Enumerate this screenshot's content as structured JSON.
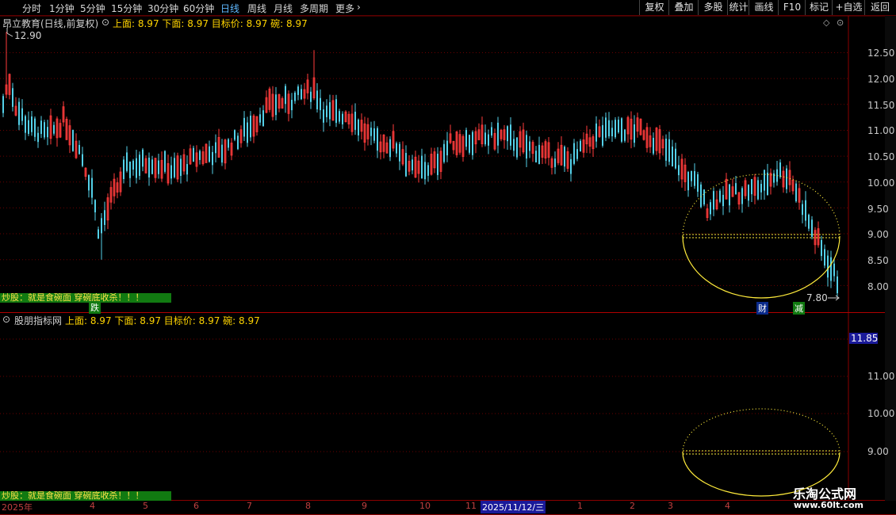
{
  "toolbar": {
    "periods": [
      "分时",
      "1分钟",
      "5分钟",
      "15分钟",
      "30分钟",
      "60分钟",
      "日线",
      "周线",
      "月线",
      "多周期",
      "更多"
    ],
    "active_period": "日线",
    "right_buttons": [
      "复权",
      "叠加",
      "多股",
      "统计",
      "画线",
      "F10",
      "标记",
      "+自选",
      "返回"
    ]
  },
  "main_panel": {
    "title": "昂立教育(日线,前复权)",
    "indicators": "上面: 8.97  下面: 8.97  目标价: 8.97  碗: 8.97",
    "high_label": "12.90",
    "low_label": "7.80",
    "y_ticks": [
      "12.50",
      "12.00",
      "11.50",
      "11.00",
      "10.50",
      "10.00",
      "9.50",
      "9.00",
      "8.50",
      "8.00"
    ],
    "banner": "炒股：就是食碗面 穿碗底收杀！！！",
    "banner_tag": "跌",
    "tag_cai": "财",
    "tag_jian": "减"
  },
  "sub_panel": {
    "title": "股朋指标网",
    "indicators": "上面: 8.97  下面: 8.97  目标价: 8.97  碗: 8.97",
    "y_ticks": [
      "11.00",
      "10.00",
      "9.00"
    ],
    "highlight_value": "11.85",
    "banner": "炒股：就是食碗面 穿碗底收杀！！！"
  },
  "x_axis": {
    "labels": [
      "2025年",
      "4",
      "5",
      "6",
      "7",
      "8",
      "9",
      "10",
      "11",
      "2025/11/12/三",
      "1",
      "2",
      "3",
      "4"
    ]
  },
  "watermark": {
    "title": "乐淘公式网",
    "url": "www.60lt.com"
  },
  "colors": {
    "up": "#ff3b3b",
    "down": "#54d0e8",
    "bowl": "#ffeb3b"
  }
}
